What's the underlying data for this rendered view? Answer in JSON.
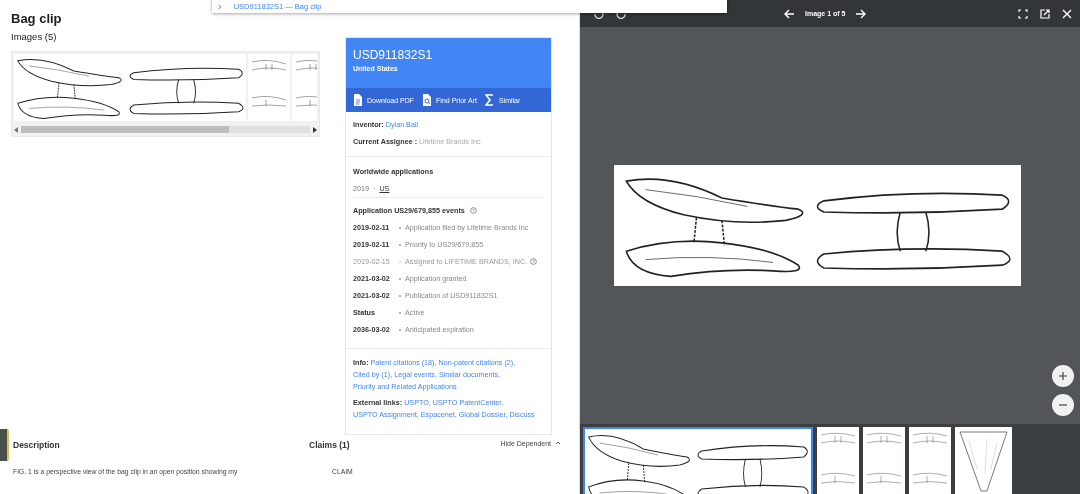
{
  "dropdown": {
    "chevron": "›",
    "text": "USD911832S1 — Bag clip"
  },
  "page": {
    "title": "Bag clip",
    "images_heading": "Images (5)"
  },
  "card": {
    "number": "USD911832S1",
    "country": "United States",
    "actions": [
      {
        "kind": "pdf",
        "label": "Download PDF"
      },
      {
        "kind": "prior",
        "label": "Find Prior Art"
      },
      {
        "kind": "similar",
        "label": "Similar"
      }
    ],
    "inventor": {
      "label": "Inventor:",
      "value": "Dylan Ball"
    },
    "assignee": {
      "label": "Current Assignee :",
      "value": "Lifetime Brands Inc"
    },
    "worldwide": {
      "heading": "Worldwide applications",
      "year": "2019",
      "separator": "·",
      "country": "US"
    },
    "events_heading": "Application US29/679,855 events",
    "events": [
      {
        "date": "2019-02-11",
        "text": "Application filed by Lifetime Brands Inc",
        "muted": false,
        "help": false
      },
      {
        "date": "2019-02-11",
        "text": "Priority to US29/679,855",
        "muted": false,
        "help": false
      },
      {
        "date": "2019-02-15",
        "text": "Assigned to LIFETIME BRANDS, INC.",
        "muted": true,
        "help": true
      },
      {
        "date": "2021-03-02",
        "text": "Application granted",
        "muted": false,
        "help": false
      },
      {
        "date": "2021-03-02",
        "text": "Publication of USD911832S1",
        "muted": false,
        "help": false
      },
      {
        "date": "Status",
        "text": "Active",
        "muted": false,
        "help": false
      },
      {
        "date": "2036-03-02",
        "text": "Anticipated expiration",
        "muted": false,
        "help": false
      }
    ],
    "info": {
      "label": "Info:",
      "links": [
        "Patent citations (18),",
        "Non-patent citations (2),",
        "Cited by (1),",
        "Legal events,",
        "Similar documents,",
        "Priority and Related Applications"
      ]
    },
    "external": {
      "label": "External links:",
      "links": [
        "USPTO,",
        "USPTO PatentCenter,",
        "USPTO Assignment,",
        "Espacenet,",
        "Global Dossier,",
        "Discuss"
      ]
    }
  },
  "description": {
    "heading": "Description",
    "text": "FIG. 1 is a perspective view of the bag clip in an open position showing my"
  },
  "claims": {
    "heading": "Claims (1)",
    "toggle": "Hide Dependent",
    "text": "CLAIM"
  },
  "viewer": {
    "counter": "Image 1 of 5",
    "thumbnails": [
      {
        "kind": "wide",
        "selected": true
      },
      {
        "kind": "narrow",
        "selected": false
      },
      {
        "kind": "narrow",
        "selected": false
      },
      {
        "kind": "narrow",
        "selected": false
      },
      {
        "kind": "cone",
        "selected": false
      }
    ]
  }
}
